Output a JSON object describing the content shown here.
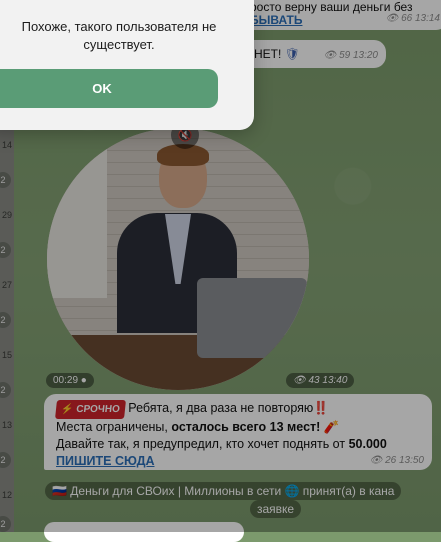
{
  "dialog": {
    "message": "Похоже, такого пользователя не существует.",
    "ok_label": "OK"
  },
  "top_messages": {
    "partial_line": "росто верну ваши деньги без",
    "partial_link": "БЫВАТЬ",
    "views_1": "66 13:14",
    "partial_text_2": "НЕТ!",
    "views_2": "59 13:20"
  },
  "video": {
    "duration": "00:29",
    "views_time": "43 13:40"
  },
  "urgent_message": {
    "tag": "⚡ СРОЧНО",
    "line1": "Ребята, я два раза не повторяю‼️",
    "line2_pre": "Места ограничены, ",
    "line2_bold": "осталось всего 13 мест!",
    "line2_emoji": "🧨",
    "line3_pre": "Давайте так, я предупредил, кто хочет поднять от ",
    "line3_bold": "50.000",
    "link": "ПИШИТЕ СЮДА",
    "views_time": "26 13:50"
  },
  "service_message": {
    "line1": "🇷🇺 Деньги для СВОих | Миллионы в сети 🌐 принят(а) в кана",
    "line2": "заявке"
  },
  "left_rail": {
    "numbers": [
      "14",
      "29",
      "27",
      "15",
      "13",
      "12"
    ],
    "badges": [
      "2",
      "2",
      "2",
      "2",
      "2",
      "2"
    ]
  },
  "colors": {
    "accent": "#5a9c76",
    "link": "#2b6fb8",
    "urgent": "#d0242b"
  }
}
